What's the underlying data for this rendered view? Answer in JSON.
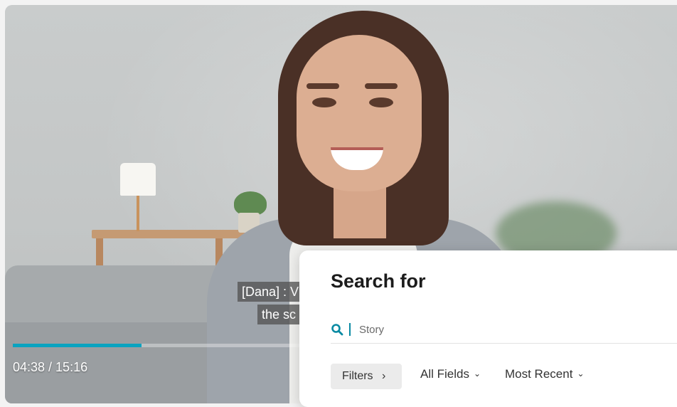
{
  "video": {
    "captions": [
      "[Dana] : V",
      "the sc"
    ],
    "timecode": "04:38 / 15:16",
    "progress": 0.306
  },
  "search_panel": {
    "title": "Search for",
    "search_placeholder": "Story",
    "filters_label": "Filters",
    "filters_chevron": "›",
    "field_dropdown": "All Fields",
    "sort_dropdown": "Most Recent",
    "dropdown_chevron": "⌄",
    "accent_color": "#0a8aa3"
  }
}
